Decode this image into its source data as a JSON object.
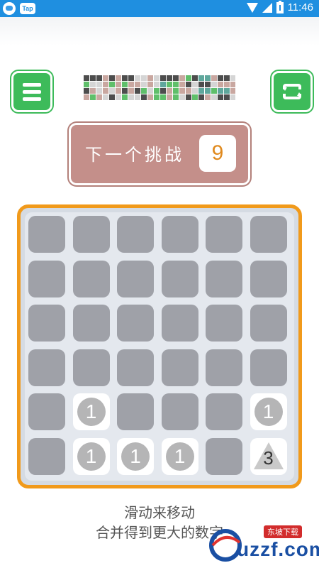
{
  "status_bar": {
    "app_badge": "Tap",
    "time": "11:46",
    "battery_level": 0.9
  },
  "toolbar": {
    "menu_icon": "menu-icon",
    "restart_icon": "restart-icon"
  },
  "logo": {
    "colors": [
      "#4d4d4d",
      "#c9a7a0",
      "#5fbf6a",
      "#d5d5d5",
      "#5fa79c",
      "#ffffff"
    ]
  },
  "challenge": {
    "label": "下一个挑战",
    "value": "9"
  },
  "board": {
    "rows": 6,
    "cols": 6,
    "cells": [
      [
        "",
        "",
        "",
        "",
        "",
        ""
      ],
      [
        "",
        "",
        "",
        "",
        "",
        ""
      ],
      [
        "",
        "",
        "",
        "",
        "",
        ""
      ],
      [
        "",
        "",
        "",
        "",
        "",
        ""
      ],
      [
        "",
        "1",
        "",
        "",
        "",
        "1"
      ],
      [
        "",
        "1",
        "1",
        "1",
        "",
        "3"
      ]
    ],
    "cell_shapes": [
      [
        "",
        "",
        "",
        "",
        "",
        ""
      ],
      [
        "",
        "",
        "",
        "",
        "",
        ""
      ],
      [
        "",
        "",
        "",
        "",
        "",
        ""
      ],
      [
        "",
        "",
        "",
        "",
        "",
        ""
      ],
      [
        "",
        "circle",
        "",
        "",
        "",
        "circle"
      ],
      [
        "",
        "circle",
        "circle",
        "circle",
        "",
        "triangle"
      ]
    ]
  },
  "hints": {
    "line1": "滑动来移动",
    "line2": "合并得到更大的数字"
  },
  "watermark": {
    "text": "uzzf.com",
    "tag": "东坡下载"
  },
  "colors": {
    "status_bar": "#1f8fe0",
    "button_green": "#3dbb5a",
    "challenge_bg": "#c48f8a",
    "challenge_value": "#e08a1e",
    "board_border": "#f19a1b",
    "empty_cell": "#9fa1a8",
    "coin": "#b5b5b6"
  }
}
